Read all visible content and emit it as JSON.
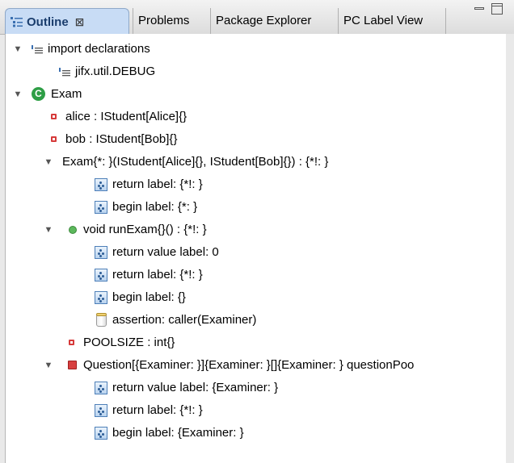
{
  "tabs": {
    "outline": "Outline",
    "outline_close": "⊠",
    "problems": "Problems",
    "package_explorer": "Package Explorer",
    "pc_label_view": "PC Label View"
  },
  "tree": {
    "import_declarations": "import declarations",
    "import_jifx": "jifx.util.DEBUG",
    "exam_class": "Exam",
    "field_alice": "alice : IStudent[Alice]{}",
    "field_bob": "bob : IStudent[Bob]{}",
    "ctor": "Exam{*: }(IStudent[Alice]{}, IStudent[Bob]{}) : {*!: }",
    "ctor_return_label": "return label: {*!: }",
    "ctor_begin_label": "begin label: {*: }",
    "run_exam": "void runExam{}() : {*!: }",
    "run_return_value_label": "return value label: 0",
    "run_return_label": "return label: {*!: }",
    "run_begin_label": "begin label: {}",
    "run_assertion": "assertion: caller(Examiner)",
    "field_poolsize": "POOLSIZE : int{}",
    "question": "Question[{Examiner: }]{Examiner: }[]{Examiner: } questionPoo",
    "q_return_value_label": "return value label: {Examiner: }",
    "q_return_label": "return label: {*!: }",
    "q_begin_label": "begin label: {Examiner: }"
  },
  "colors": {
    "active_tab": "#c8dcf5",
    "class_icon": "#2e9e46",
    "private_field": "#d63a3a",
    "public_method": "#5cb85c"
  },
  "icons": {
    "outline_tab": "outline-view-icon",
    "imports": "import-icon",
    "class": "class-icon",
    "private_field": "private-field-icon",
    "method": "method-icon",
    "label": "label-icon",
    "assertion": "assertion-icon"
  }
}
